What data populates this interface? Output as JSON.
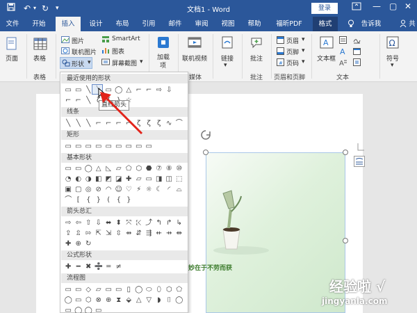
{
  "titlebar": {
    "title": "文档1 - Word",
    "login_label": "登录",
    "save_icon": "save-icon",
    "undo_icon": "undo-icon",
    "redo_icon": "redo-icon",
    "customize_icon": "customize-qat-icon"
  },
  "tabs": [
    {
      "label": "文件"
    },
    {
      "label": "开始"
    },
    {
      "label": "插入"
    },
    {
      "label": "设计"
    },
    {
      "label": "布局"
    },
    {
      "label": "引用"
    },
    {
      "label": "邮件"
    },
    {
      "label": "审阅"
    },
    {
      "label": "视图"
    },
    {
      "label": "帮助"
    },
    {
      "label": "福昕PDF"
    },
    {
      "label": "格式"
    }
  ],
  "tell_me": "告诉我",
  "share_short": "共",
  "ribbon": {
    "pages_label": "页面",
    "table_label": "表格",
    "table_group": "表格",
    "pictures": "图片",
    "online_pictures": "联机图片",
    "shapes": "形状",
    "smartart": "SmartArt",
    "chart": "图表",
    "screenshot": "屏幕截图",
    "addins_line1": "加载",
    "addins_line2": "项",
    "online_video": "联机视频",
    "media_group": "媒体",
    "links": "链接",
    "comments": "批注",
    "comments_group": "批注",
    "header": "页眉",
    "footer": "页脚",
    "page_number": "页码",
    "header_footer_group": "页眉和页脚",
    "textbox": "文本框",
    "text_group": "文本",
    "symbols": "符号",
    "illustrations_group_partial": "插图"
  },
  "shapes_menu": {
    "recent": "最近使用的形状",
    "lines": "线条",
    "rectangles": "矩形",
    "basic": "基本形状",
    "block_arrows": "箭头总汇",
    "equation": "公式形状",
    "flowchart": "流程图",
    "tooltip": "直线箭头",
    "recent_shapes": [
      "▭",
      "▭",
      "╲",
      "╲",
      "▭",
      "◯",
      "△",
      "⌐",
      "⌐",
      "⇨",
      "⇩"
    ],
    "recent_shapes_2": [
      "⌐",
      "⌐",
      "╲",
      "ζ",
      "{",
      "}",
      "☆"
    ],
    "line_shapes": [
      "╲",
      "╲",
      "╲",
      "⌐",
      "⌐",
      "⌐",
      "⌐",
      "ζ",
      "ζ",
      "ζ",
      "∿",
      "⌒"
    ],
    "rect_shapes": [
      "▭",
      "▭",
      "▭",
      "▭",
      "▭",
      "▭",
      "▭",
      "▭",
      "▭"
    ],
    "basic_shapes_1": [
      "▭",
      "▭",
      "◯",
      "△",
      "◺",
      "▱",
      "⬠",
      "⬡",
      "⬣",
      "⑦",
      "⑧",
      "⑩"
    ],
    "basic_shapes_2": [
      "◔",
      "◐",
      "◑",
      "◧",
      "◩",
      "◪",
      "✚",
      "▱",
      "▭",
      "◨",
      "◫",
      "⬚"
    ],
    "basic_shapes_3": [
      "▣",
      "▢",
      "◎",
      "⊘",
      "◠",
      "☺",
      "♡",
      "⚡",
      "☼",
      "☾",
      "◜",
      "⌓"
    ],
    "basic_shapes_4": [
      "⌒",
      "[",
      "{",
      "}",
      "(",
      "{",
      "}"
    ],
    "arrow_shapes_1": [
      "⇨",
      "⇦",
      "⇧",
      "⇩",
      "⬌",
      "⬍",
      "⤧",
      "⤪",
      "⤴",
      "↰",
      "↱",
      "↳"
    ],
    "arrow_shapes_2": [
      "⇪",
      "⇫",
      "⇰",
      "⇱",
      "⇲",
      "⇳",
      "⇴",
      "⇵",
      "⇶",
      "⇷",
      "⇸",
      "⇹"
    ],
    "arrow_shapes_3": [
      "✚",
      "⊕",
      "↻"
    ],
    "equation_shapes": [
      "✚",
      "━",
      "✖",
      "➗",
      "═",
      "≠"
    ],
    "flow_shapes_1": [
      "▭",
      "▭",
      "◇",
      "▱",
      "▭",
      "▭",
      "▯",
      "◯",
      "⬭",
      "⬯",
      "⬡",
      "⬠"
    ],
    "flow_shapes_2": [
      "◯",
      "▭",
      "⬡",
      "⊗",
      "⊕",
      "⧗",
      "⬙",
      "△",
      "▽",
      "◗",
      "⌷",
      "◯"
    ],
    "flow_shapes_3": [
      "▭",
      "◯",
      "◯",
      "▭"
    ]
  },
  "document": {
    "picture_caption": "涉妙在于不劳而获"
  },
  "watermark": {
    "text": "经验啦 √",
    "url": "jingyanla.com"
  }
}
